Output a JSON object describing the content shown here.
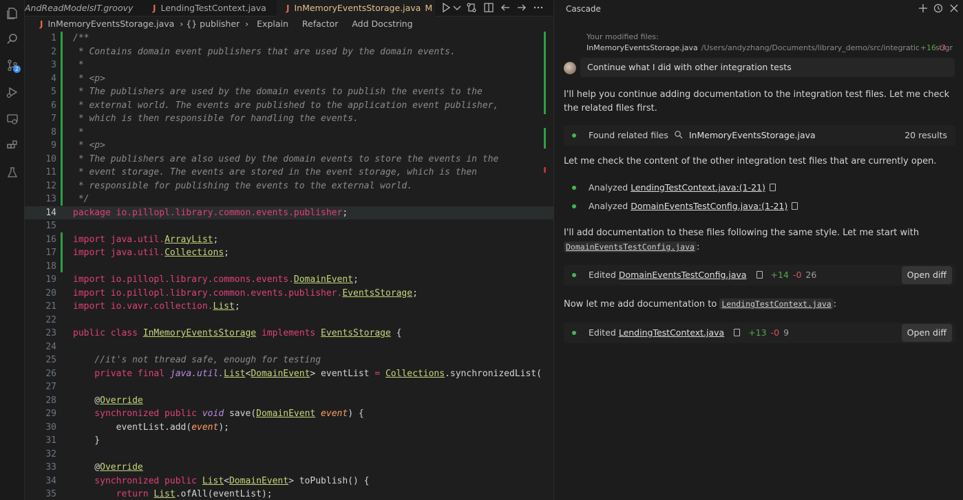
{
  "editor": {
    "tabs": [
      {
        "label": "AndReadModelsIT.groovy",
        "active": false
      },
      {
        "label": "LendingTestContext.java",
        "active": false
      },
      {
        "label": "InMemoryEventsStorage.java",
        "active": true,
        "modified": "M"
      }
    ],
    "breadcrumb": {
      "file": "InMemoryEventsStorage.java",
      "symbol": "{} publisher",
      "actions": [
        "Explain",
        "Refactor",
        "Add Docstring"
      ]
    },
    "current_line": 14,
    "lines": [
      {
        "n": "1",
        "tokens": [
          {
            "c": "comment",
            "t": "/**"
          }
        ]
      },
      {
        "n": "2",
        "tokens": [
          {
            "c": "comment",
            "t": " * Contains domain event publishers that are used by the domain events."
          }
        ]
      },
      {
        "n": "3",
        "tokens": [
          {
            "c": "comment",
            "t": " *"
          }
        ]
      },
      {
        "n": "4",
        "tokens": [
          {
            "c": "comment",
            "t": " * <p>"
          }
        ]
      },
      {
        "n": "5",
        "tokens": [
          {
            "c": "comment",
            "t": " * The publishers are used by the domain events to publish the events to the"
          }
        ]
      },
      {
        "n": "6",
        "tokens": [
          {
            "c": "comment",
            "t": " * external world. The events are published to the application event publisher,"
          }
        ]
      },
      {
        "n": "7",
        "tokens": [
          {
            "c": "comment",
            "t": " * which is then responsible for handling the events."
          }
        ]
      },
      {
        "n": "8",
        "tokens": [
          {
            "c": "comment",
            "t": " *"
          }
        ]
      },
      {
        "n": "9",
        "tokens": [
          {
            "c": "comment",
            "t": " * <p>"
          }
        ]
      },
      {
        "n": "10",
        "tokens": [
          {
            "c": "comment",
            "t": " * The publishers are also used by the domain events to store the events in the"
          }
        ]
      },
      {
        "n": "11",
        "tokens": [
          {
            "c": "comment",
            "t": " * event storage. The events are stored in the event storage, which is then"
          }
        ]
      },
      {
        "n": "12",
        "tokens": [
          {
            "c": "comment",
            "t": " * responsible for publishing the events to the external world."
          }
        ]
      },
      {
        "n": "13",
        "tokens": [
          {
            "c": "comment",
            "t": " */"
          }
        ]
      },
      {
        "n": "14",
        "tokens": [
          {
            "c": "pk",
            "t": "package io.pillopl.library.common.events.publisher"
          },
          {
            "c": "",
            "t": ";"
          }
        ]
      },
      {
        "n": "15",
        "tokens": []
      },
      {
        "n": "16",
        "tokens": [
          {
            "c": "kw",
            "t": "import java.util."
          },
          {
            "c": "ty",
            "t": "ArrayList"
          },
          {
            "c": "",
            "t": ";"
          }
        ]
      },
      {
        "n": "17",
        "tokens": [
          {
            "c": "kw",
            "t": "import java.util."
          },
          {
            "c": "ty",
            "t": "Collections"
          },
          {
            "c": "",
            "t": ";"
          }
        ]
      },
      {
        "n": "18",
        "tokens": []
      },
      {
        "n": "19",
        "tokens": [
          {
            "c": "kw",
            "t": "import io.pillopl.library.commons.events."
          },
          {
            "c": "ty",
            "t": "DomainEvent"
          },
          {
            "c": "",
            "t": ";"
          }
        ]
      },
      {
        "n": "20",
        "tokens": [
          {
            "c": "kw",
            "t": "import io.pillopl.library.common.events.publisher."
          },
          {
            "c": "ty",
            "t": "EventsStorage"
          },
          {
            "c": "",
            "t": ";"
          }
        ]
      },
      {
        "n": "21",
        "tokens": [
          {
            "c": "kw",
            "t": "import io.vavr.collection."
          },
          {
            "c": "ty",
            "t": "List"
          },
          {
            "c": "",
            "t": ";"
          }
        ]
      },
      {
        "n": "22",
        "tokens": []
      },
      {
        "n": "23",
        "tokens": [
          {
            "c": "kw",
            "t": "public class "
          },
          {
            "c": "ty",
            "t": "InMemoryEventsStorage"
          },
          {
            "c": "kw",
            "t": " implements "
          },
          {
            "c": "ty",
            "t": "EventsStorage"
          },
          {
            "c": "",
            "t": " {"
          }
        ]
      },
      {
        "n": "24",
        "tokens": []
      },
      {
        "n": "25",
        "tokens": [
          {
            "c": "comment",
            "t": "    //it's not thread safe, enough for testing"
          }
        ]
      },
      {
        "n": "26",
        "tokens": [
          {
            "c": "kw",
            "t": "    private final "
          },
          {
            "c": "kwi",
            "t": "java.util."
          },
          {
            "c": "ty",
            "t": "List"
          },
          {
            "c": "",
            "t": "<"
          },
          {
            "c": "ty",
            "t": "DomainEvent"
          },
          {
            "c": "",
            "t": "> eventList "
          },
          {
            "c": "kw",
            "t": "="
          },
          {
            "c": "",
            "t": " "
          },
          {
            "c": "ty",
            "t": "Collections"
          },
          {
            "c": "",
            "t": ".synchronizedList("
          }
        ]
      },
      {
        "n": "27",
        "tokens": []
      },
      {
        "n": "28",
        "tokens": [
          {
            "c": "",
            "t": "    @"
          },
          {
            "c": "ty",
            "t": "Override"
          }
        ]
      },
      {
        "n": "29",
        "tokens": [
          {
            "c": "kw",
            "t": "    synchronized public "
          },
          {
            "c": "kwi",
            "t": "void"
          },
          {
            "c": "",
            "t": " save("
          },
          {
            "c": "ty",
            "t": "DomainEvent"
          },
          {
            "c": "",
            "t": " "
          },
          {
            "c": "it",
            "t": "event"
          },
          {
            "c": "",
            "t": ") {"
          }
        ]
      },
      {
        "n": "30",
        "tokens": [
          {
            "c": "",
            "t": "        eventList.add("
          },
          {
            "c": "it",
            "t": "event"
          },
          {
            "c": "",
            "t": ");"
          }
        ]
      },
      {
        "n": "31",
        "tokens": [
          {
            "c": "",
            "t": "    }"
          }
        ]
      },
      {
        "n": "32",
        "tokens": []
      },
      {
        "n": "33",
        "tokens": [
          {
            "c": "",
            "t": "    @"
          },
          {
            "c": "ty",
            "t": "Override"
          }
        ]
      },
      {
        "n": "34",
        "tokens": [
          {
            "c": "kw",
            "t": "    synchronized public "
          },
          {
            "c": "ty",
            "t": "List"
          },
          {
            "c": "",
            "t": "<"
          },
          {
            "c": "ty",
            "t": "DomainEvent"
          },
          {
            "c": "",
            "t": "> toPublish() {"
          }
        ]
      },
      {
        "n": "35",
        "tokens": [
          {
            "c": "kw",
            "t": "        return "
          },
          {
            "c": "ty",
            "t": "List"
          },
          {
            "c": "",
            "t": ".ofAll(eventList);"
          }
        ]
      }
    ]
  },
  "cascade": {
    "title": "Cascade",
    "modified_label": "Your modified files:",
    "modified_file": "InMemoryEventsStorage.java",
    "modified_path": "/Users/andyzhang/Documents/library_demo/src/integration-test/groovy",
    "modified_plus": "+16",
    "modified_minus": "-3",
    "user_message": "Continue what I did with other integration tests",
    "reply_1": "I'll help you continue adding documentation to the integration test files. Let me check the related files first.",
    "search": {
      "prefix": "Found related files",
      "query": "InMemoryEventsStorage.java",
      "results": "20 results"
    },
    "reply_2": "Let me check the content of the other integration test files that are currently open.",
    "analyzed": [
      {
        "verb": "Analyzed",
        "file": "LendingTestContext.java:(1-21)"
      },
      {
        "verb": "Analyzed",
        "file": "DomainEventsTestConfig.java:(1-21)"
      }
    ],
    "reply_3": "I'll add documentation to these files following the same style. Let me start with",
    "reply_3_code": "DomainEventsTestConfig.java",
    "reply_3_end": ":",
    "edit_1": {
      "verb": "Edited",
      "file": "DomainEventsTestConfig.java",
      "plus": "+14",
      "minus": "-0",
      "count": "26",
      "button": "Open diff"
    },
    "reply_4": "Now let me add documentation to",
    "reply_4_code": "LendingTestContext.java",
    "reply_4_end": ":",
    "edit_2": {
      "verb": "Edited",
      "file": "LendingTestContext.java",
      "plus": "+13",
      "minus": "-0",
      "count": "9",
      "button": "Open diff"
    }
  },
  "colors": {
    "accent_added": "#2ea043",
    "keyword": "#e0407a",
    "type": "#c5d77a",
    "java_icon": "#e06c4f"
  }
}
